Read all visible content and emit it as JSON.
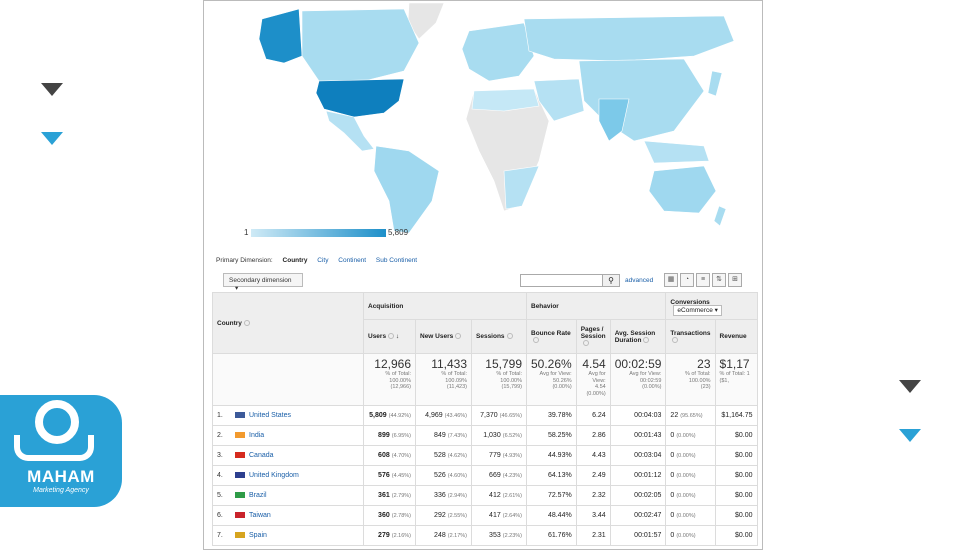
{
  "brand": {
    "name": "MAHAM",
    "tagline": "Marketing Agency"
  },
  "map": {
    "legend_min": "1",
    "legend_max": "5,809",
    "colors": {
      "low": "#cfeaf6",
      "high": "#1d8fc9",
      "none": "#e6e6e6"
    }
  },
  "dimensions": {
    "label": "Primary Dimension:",
    "current": "Country",
    "links": [
      "City",
      "Continent",
      "Sub Continent"
    ]
  },
  "controls": {
    "secondary_dimension": "Secondary dimension",
    "advanced": "advanced"
  },
  "groups": {
    "acquisition": "Acquisition",
    "behavior": "Behavior",
    "conversions": "Conversions",
    "ecommerce": "eCommerce"
  },
  "columns": {
    "country": "Country",
    "users": "Users",
    "new_users": "New Users",
    "sessions": "Sessions",
    "bounce_rate": "Bounce Rate",
    "pages_session": "Pages / Session",
    "avg_session": "Avg. Session Duration",
    "transactions": "Transactions",
    "revenue": "Revenue"
  },
  "totals": {
    "users": {
      "value": "12,966",
      "l1": "% of Total:",
      "l2": "100.00%",
      "l3": "(12,966)"
    },
    "new_users": {
      "value": "11,433",
      "l1": "% of Total:",
      "l2": "100.09%",
      "l3": "(11,423)"
    },
    "sessions": {
      "value": "15,799",
      "l1": "% of Total:",
      "l2": "100.00%",
      "l3": "(15,799)"
    },
    "bounce_rate": {
      "value": "50.26%",
      "l1": "Avg for View:",
      "l2": "50.26%",
      "l3": "(0.00%)"
    },
    "pages_session": {
      "value": "4.54",
      "l1": "Avg for",
      "l2": "View:",
      "l3": "4.54",
      "l4": "(0.00%)"
    },
    "avg_session": {
      "value": "00:02:59",
      "l1": "Avg for View:",
      "l2": "00:02:59",
      "l3": "(0.00%)"
    },
    "transactions": {
      "value": "23",
      "l1": "% of Total:",
      "l2": "100.00%",
      "l3": "(23)"
    },
    "revenue": {
      "value": "$1,17",
      "l1": "% of Total: 1",
      "l2": "($1,"
    }
  },
  "rows": [
    {
      "rank": "1.",
      "country": "United States",
      "flag": "#3c5a9a",
      "users": "5,809",
      "users_pct": "(44.92%)",
      "new_users": "4,969",
      "new_pct": "(43.46%)",
      "sessions": "7,370",
      "sess_pct": "(46.65%)",
      "bounce": "39.78%",
      "pages": "6.24",
      "dur": "00:04:03",
      "trans": "22",
      "trans_pct": "(95.65%)",
      "rev": "$1,164.75"
    },
    {
      "rank": "2.",
      "country": "India",
      "flag": "#f29a2e",
      "users": "899",
      "users_pct": "(6.95%)",
      "new_users": "849",
      "new_pct": "(7.43%)",
      "sessions": "1,030",
      "sess_pct": "(6.52%)",
      "bounce": "58.25%",
      "pages": "2.86",
      "dur": "00:01:43",
      "trans": "0",
      "trans_pct": "(0.00%)",
      "rev": "$0.00"
    },
    {
      "rank": "3.",
      "country": "Canada",
      "flag": "#d52b1e",
      "users": "608",
      "users_pct": "(4.70%)",
      "new_users": "528",
      "new_pct": "(4.62%)",
      "sessions": "779",
      "sess_pct": "(4.93%)",
      "bounce": "44.93%",
      "pages": "4.43",
      "dur": "00:03:04",
      "trans": "0",
      "trans_pct": "(0.00%)",
      "rev": "$0.00"
    },
    {
      "rank": "4.",
      "country": "United Kingdom",
      "flag": "#2d3f8f",
      "users": "576",
      "users_pct": "(4.45%)",
      "new_users": "526",
      "new_pct": "(4.60%)",
      "sessions": "669",
      "sess_pct": "(4.23%)",
      "bounce": "64.13%",
      "pages": "2.49",
      "dur": "00:01:12",
      "trans": "0",
      "trans_pct": "(0.00%)",
      "rev": "$0.00"
    },
    {
      "rank": "5.",
      "country": "Brazil",
      "flag": "#2f9b47",
      "users": "361",
      "users_pct": "(2.79%)",
      "new_users": "336",
      "new_pct": "(2.94%)",
      "sessions": "412",
      "sess_pct": "(2.61%)",
      "bounce": "72.57%",
      "pages": "2.32",
      "dur": "00:02:05",
      "trans": "0",
      "trans_pct": "(0.00%)",
      "rev": "$0.00"
    },
    {
      "rank": "6.",
      "country": "Taiwan",
      "flag": "#c9232b",
      "users": "360",
      "users_pct": "(2.78%)",
      "new_users": "292",
      "new_pct": "(2.55%)",
      "sessions": "417",
      "sess_pct": "(2.64%)",
      "bounce": "48.44%",
      "pages": "3.44",
      "dur": "00:02:47",
      "trans": "0",
      "trans_pct": "(0.00%)",
      "rev": "$0.00"
    },
    {
      "rank": "7.",
      "country": "Spain",
      "flag": "#d6a41f",
      "users": "279",
      "users_pct": "(2.16%)",
      "new_users": "248",
      "new_pct": "(2.17%)",
      "sessions": "353",
      "sess_pct": "(2.23%)",
      "bounce": "61.76%",
      "pages": "2.31",
      "dur": "00:01:57",
      "trans": "0",
      "trans_pct": "(0.00%)",
      "rev": "$0.00"
    }
  ]
}
